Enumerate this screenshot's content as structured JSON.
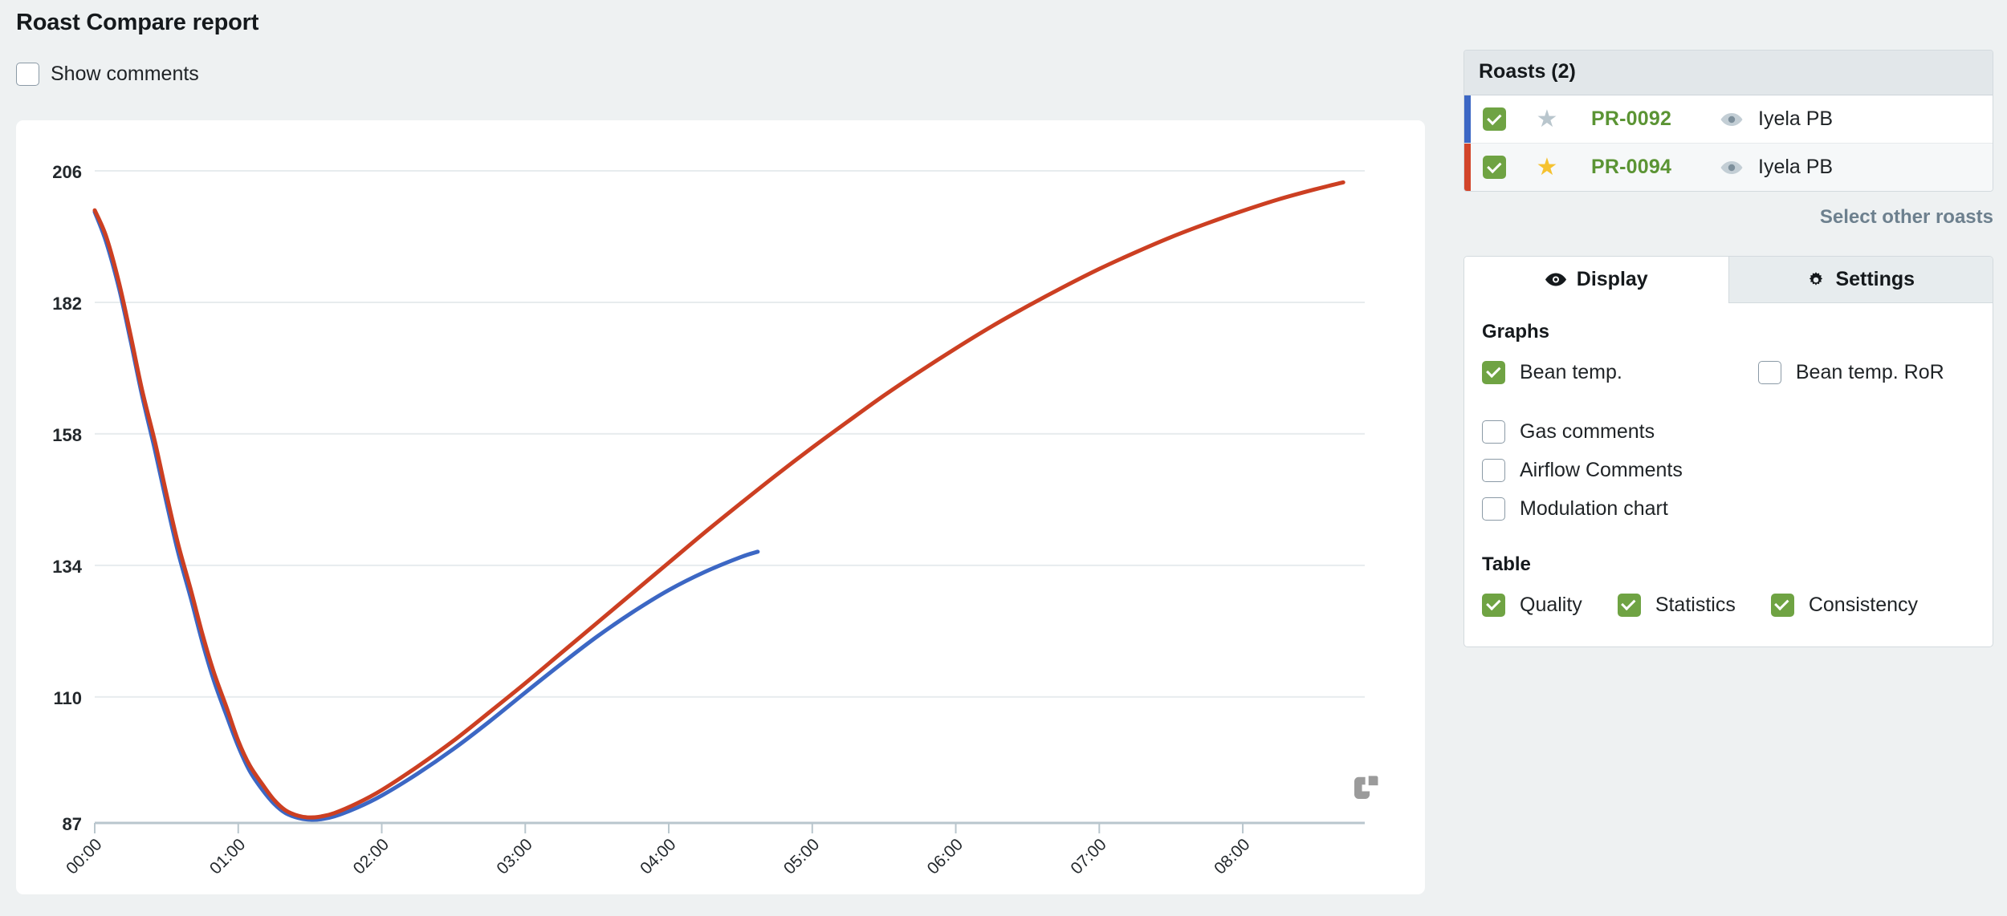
{
  "header": {
    "title": "Roast Compare report",
    "show_comments_label": "Show comments",
    "show_comments_checked": false
  },
  "roasts_panel": {
    "heading": "Roasts (2)",
    "select_other_label": "Select other roasts",
    "rows": [
      {
        "checked": true,
        "starred": false,
        "star_glyph": "★",
        "id": "PR-0092",
        "name": "Iyela PB",
        "color": "#3c67c4"
      },
      {
        "checked": true,
        "starred": true,
        "star_glyph": "★",
        "id": "PR-0094",
        "name": "Iyela PB",
        "color": "#d2452a"
      }
    ]
  },
  "tabs": {
    "display_label": "Display",
    "settings_label": "Settings",
    "active": "Display",
    "display_icon": "eye-icon",
    "settings_icon": "gear-icon"
  },
  "display_panel": {
    "graphs_title": "Graphs",
    "graph_options": [
      {
        "label": "Bean temp.",
        "checked": true
      },
      {
        "label": "Bean temp. RoR",
        "checked": false
      },
      {
        "label": "Gas comments",
        "checked": false
      },
      {
        "label": "Airflow Comments",
        "checked": false
      },
      {
        "label": "Modulation chart",
        "checked": false
      }
    ],
    "table_title": "Table",
    "table_options": [
      {
        "label": "Quality",
        "checked": true
      },
      {
        "label": "Statistics",
        "checked": true
      },
      {
        "label": "Consistency",
        "checked": true
      }
    ]
  },
  "chart_card": {
    "resize_icon": "collapse-icon"
  },
  "colors": {
    "accent_green": "#6fa343",
    "roast_blue": "#3c67c4",
    "roast_red": "#cc3f22",
    "link_gray": "#6d808e",
    "star_gold": "#f5c230",
    "star_gray": "#b9c6cd",
    "page_bg": "#eef1f2"
  },
  "chart_data": {
    "type": "line",
    "title": "",
    "xlabel": "",
    "ylabel": "",
    "grid": true,
    "legend_position": "none",
    "ylim": [
      87,
      212
    ],
    "yticks": [
      87,
      110,
      134,
      158,
      182,
      206
    ],
    "xlim": [
      0,
      8.85
    ],
    "xticks": [
      0,
      1,
      2,
      3,
      4,
      5,
      6,
      7,
      8
    ],
    "xtick_labels": [
      "00:00",
      "01:00",
      "02:00",
      "03:00",
      "04:00",
      "05:00",
      "06:00",
      "07:00",
      "08:00"
    ],
    "x_unit": "minutes",
    "series": [
      {
        "name": "PR-0092",
        "color": "#3c67c4",
        "x": [
          0.0,
          0.08,
          0.17,
          0.25,
          0.33,
          0.42,
          0.5,
          0.58,
          0.67,
          0.75,
          0.83,
          0.92,
          1.0,
          1.08,
          1.17,
          1.25,
          1.33,
          1.42,
          1.5,
          1.58,
          1.67,
          1.83,
          2.0,
          2.25,
          2.5,
          2.75,
          3.0,
          3.25,
          3.5,
          3.75,
          4.0,
          4.25,
          4.5,
          4.62
        ],
        "y": [
          198.5,
          193.0,
          184.5,
          175.0,
          165.0,
          155.0,
          145.5,
          136.5,
          128.0,
          120.0,
          113.0,
          106.5,
          101.0,
          96.5,
          93.0,
          90.5,
          88.8,
          87.9,
          87.6,
          87.7,
          88.2,
          89.8,
          92.0,
          96.0,
          100.5,
          105.5,
          110.8,
          116.0,
          121.0,
          125.5,
          129.5,
          132.8,
          135.5,
          136.5
        ]
      },
      {
        "name": "PR-0094",
        "color": "#cc3f22",
        "x": [
          0.0,
          0.08,
          0.17,
          0.25,
          0.33,
          0.42,
          0.5,
          0.58,
          0.67,
          0.75,
          0.83,
          0.92,
          1.0,
          1.08,
          1.17,
          1.25,
          1.33,
          1.42,
          1.5,
          1.58,
          1.67,
          1.83,
          2.0,
          2.25,
          2.5,
          2.75,
          3.0,
          3.25,
          3.5,
          3.75,
          4.0,
          4.25,
          4.5,
          4.75,
          5.0,
          5.25,
          5.5,
          5.75,
          6.0,
          6.25,
          6.5,
          6.75,
          7.0,
          7.25,
          7.5,
          7.75,
          8.0,
          8.25,
          8.5,
          8.7
        ],
        "y": [
          198.8,
          194.0,
          185.5,
          176.0,
          166.0,
          156.5,
          147.0,
          138.0,
          129.5,
          121.5,
          114.5,
          108.0,
          102.0,
          97.5,
          94.0,
          91.2,
          89.3,
          88.3,
          88.0,
          88.2,
          88.8,
          90.6,
          93.0,
          97.3,
          102.0,
          107.2,
          112.5,
          118.0,
          123.5,
          129.0,
          134.5,
          140.0,
          145.3,
          150.5,
          155.5,
          160.3,
          165.0,
          169.4,
          173.6,
          177.6,
          181.3,
          184.8,
          188.1,
          191.1,
          193.9,
          196.4,
          198.7,
          200.8,
          202.6,
          203.9
        ]
      }
    ]
  }
}
